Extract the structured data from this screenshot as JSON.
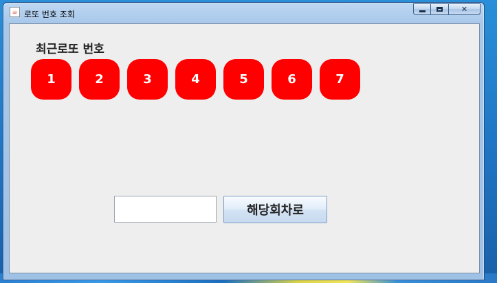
{
  "window": {
    "title": "로또 번호 조회",
    "app_icon": "java-icon"
  },
  "content": {
    "section_title": "최근로또 번호",
    "balls": [
      "1",
      "2",
      "3",
      "4",
      "5",
      "6",
      "7"
    ],
    "ball_color": "#ff0000",
    "round_input": {
      "value": "",
      "placeholder": ""
    },
    "search_button_label": "해당회차로"
  }
}
